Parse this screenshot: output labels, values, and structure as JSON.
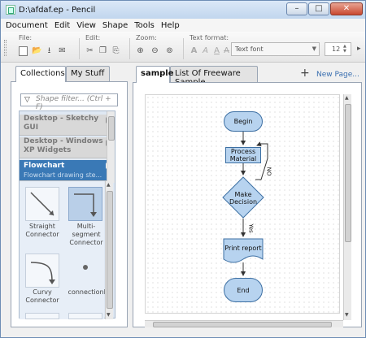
{
  "window": {
    "title": "D:\\afdaf.ep - Pencil",
    "minimize": "–",
    "maximize": "□",
    "close": "✕"
  },
  "menu": [
    "Document",
    "Edit",
    "View",
    "Shape",
    "Tools",
    "Help"
  ],
  "toolbar": {
    "file_label": "File:",
    "edit_label": "Edit:",
    "zoom_label": "Zoom:",
    "text_format_label": "Text format:",
    "font_value": "Text font",
    "font_size": "12",
    "bold": "A",
    "italic": "A",
    "underline": "A",
    "strike": "A"
  },
  "left_panel": {
    "tabs": [
      "Collections",
      "My Stuff"
    ],
    "filter_placeholder": "Shape filter... (Ctrl + F)",
    "collections": [
      {
        "name": "Desktop - Sketchy GUI",
        "desc": ""
      },
      {
        "name": "Desktop - Windows XP Widgets",
        "desc": ""
      },
      {
        "name": "Flowchart",
        "desc": "Flowchart drawing ste..."
      }
    ],
    "shapes": [
      "Straight Connector",
      "Multi-segment Connector",
      "Curvy Connector",
      "connectionP"
    ]
  },
  "right_panel": {
    "tabs": [
      "sample",
      "List Of Freeware Sample"
    ],
    "new_page_label": "New Page..."
  },
  "diagram": {
    "begin": "Begin",
    "process": "Process Material",
    "decision": "Make Decision",
    "print": "Print report",
    "end": "End",
    "no_label": "NO",
    "yes_label": "Yes"
  },
  "colors": {
    "accent": "#3a79b6",
    "node_fill": "#b7d3ef",
    "node_stroke": "#3c6fa3"
  },
  "icons": [
    "new-doc-icon",
    "open-icon",
    "save-icon",
    "export-icon",
    "cut-icon",
    "copy-icon",
    "paste-icon",
    "zoom-in-icon",
    "zoom-out-icon",
    "zoom-fit-icon",
    "filter-icon",
    "plus-icon"
  ]
}
